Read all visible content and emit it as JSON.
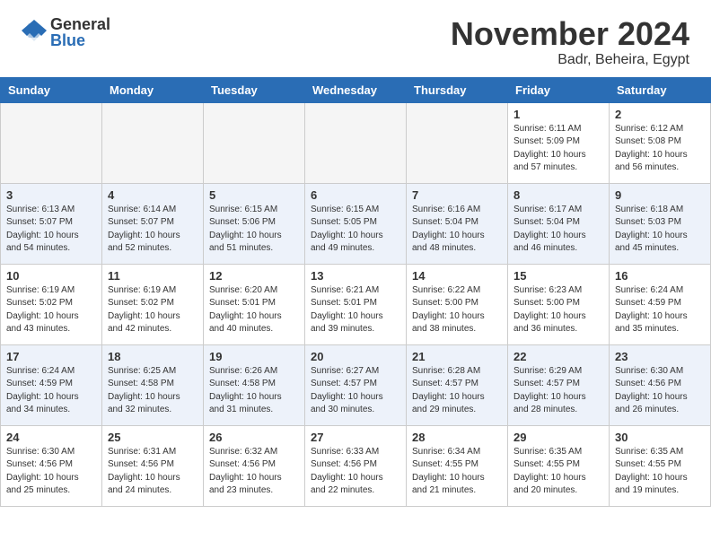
{
  "header": {
    "logo_general": "General",
    "logo_blue": "Blue",
    "month_title": "November 2024",
    "location": "Badr, Beheira, Egypt"
  },
  "calendar": {
    "days_of_week": [
      "Sunday",
      "Monday",
      "Tuesday",
      "Wednesday",
      "Thursday",
      "Friday",
      "Saturday"
    ],
    "weeks": [
      [
        {
          "day": "",
          "info": ""
        },
        {
          "day": "",
          "info": ""
        },
        {
          "day": "",
          "info": ""
        },
        {
          "day": "",
          "info": ""
        },
        {
          "day": "",
          "info": ""
        },
        {
          "day": "1",
          "info": "Sunrise: 6:11 AM\nSunset: 5:09 PM\nDaylight: 10 hours and 57 minutes."
        },
        {
          "day": "2",
          "info": "Sunrise: 6:12 AM\nSunset: 5:08 PM\nDaylight: 10 hours and 56 minutes."
        }
      ],
      [
        {
          "day": "3",
          "info": "Sunrise: 6:13 AM\nSunset: 5:07 PM\nDaylight: 10 hours and 54 minutes."
        },
        {
          "day": "4",
          "info": "Sunrise: 6:14 AM\nSunset: 5:07 PM\nDaylight: 10 hours and 52 minutes."
        },
        {
          "day": "5",
          "info": "Sunrise: 6:15 AM\nSunset: 5:06 PM\nDaylight: 10 hours and 51 minutes."
        },
        {
          "day": "6",
          "info": "Sunrise: 6:15 AM\nSunset: 5:05 PM\nDaylight: 10 hours and 49 minutes."
        },
        {
          "day": "7",
          "info": "Sunrise: 6:16 AM\nSunset: 5:04 PM\nDaylight: 10 hours and 48 minutes."
        },
        {
          "day": "8",
          "info": "Sunrise: 6:17 AM\nSunset: 5:04 PM\nDaylight: 10 hours and 46 minutes."
        },
        {
          "day": "9",
          "info": "Sunrise: 6:18 AM\nSunset: 5:03 PM\nDaylight: 10 hours and 45 minutes."
        }
      ],
      [
        {
          "day": "10",
          "info": "Sunrise: 6:19 AM\nSunset: 5:02 PM\nDaylight: 10 hours and 43 minutes."
        },
        {
          "day": "11",
          "info": "Sunrise: 6:19 AM\nSunset: 5:02 PM\nDaylight: 10 hours and 42 minutes."
        },
        {
          "day": "12",
          "info": "Sunrise: 6:20 AM\nSunset: 5:01 PM\nDaylight: 10 hours and 40 minutes."
        },
        {
          "day": "13",
          "info": "Sunrise: 6:21 AM\nSunset: 5:01 PM\nDaylight: 10 hours and 39 minutes."
        },
        {
          "day": "14",
          "info": "Sunrise: 6:22 AM\nSunset: 5:00 PM\nDaylight: 10 hours and 38 minutes."
        },
        {
          "day": "15",
          "info": "Sunrise: 6:23 AM\nSunset: 5:00 PM\nDaylight: 10 hours and 36 minutes."
        },
        {
          "day": "16",
          "info": "Sunrise: 6:24 AM\nSunset: 4:59 PM\nDaylight: 10 hours and 35 minutes."
        }
      ],
      [
        {
          "day": "17",
          "info": "Sunrise: 6:24 AM\nSunset: 4:59 PM\nDaylight: 10 hours and 34 minutes."
        },
        {
          "day": "18",
          "info": "Sunrise: 6:25 AM\nSunset: 4:58 PM\nDaylight: 10 hours and 32 minutes."
        },
        {
          "day": "19",
          "info": "Sunrise: 6:26 AM\nSunset: 4:58 PM\nDaylight: 10 hours and 31 minutes."
        },
        {
          "day": "20",
          "info": "Sunrise: 6:27 AM\nSunset: 4:57 PM\nDaylight: 10 hours and 30 minutes."
        },
        {
          "day": "21",
          "info": "Sunrise: 6:28 AM\nSunset: 4:57 PM\nDaylight: 10 hours and 29 minutes."
        },
        {
          "day": "22",
          "info": "Sunrise: 6:29 AM\nSunset: 4:57 PM\nDaylight: 10 hours and 28 minutes."
        },
        {
          "day": "23",
          "info": "Sunrise: 6:30 AM\nSunset: 4:56 PM\nDaylight: 10 hours and 26 minutes."
        }
      ],
      [
        {
          "day": "24",
          "info": "Sunrise: 6:30 AM\nSunset: 4:56 PM\nDaylight: 10 hours and 25 minutes."
        },
        {
          "day": "25",
          "info": "Sunrise: 6:31 AM\nSunset: 4:56 PM\nDaylight: 10 hours and 24 minutes."
        },
        {
          "day": "26",
          "info": "Sunrise: 6:32 AM\nSunset: 4:56 PM\nDaylight: 10 hours and 23 minutes."
        },
        {
          "day": "27",
          "info": "Sunrise: 6:33 AM\nSunset: 4:56 PM\nDaylight: 10 hours and 22 minutes."
        },
        {
          "day": "28",
          "info": "Sunrise: 6:34 AM\nSunset: 4:55 PM\nDaylight: 10 hours and 21 minutes."
        },
        {
          "day": "29",
          "info": "Sunrise: 6:35 AM\nSunset: 4:55 PM\nDaylight: 10 hours and 20 minutes."
        },
        {
          "day": "30",
          "info": "Sunrise: 6:35 AM\nSunset: 4:55 PM\nDaylight: 10 hours and 19 minutes."
        }
      ]
    ]
  }
}
